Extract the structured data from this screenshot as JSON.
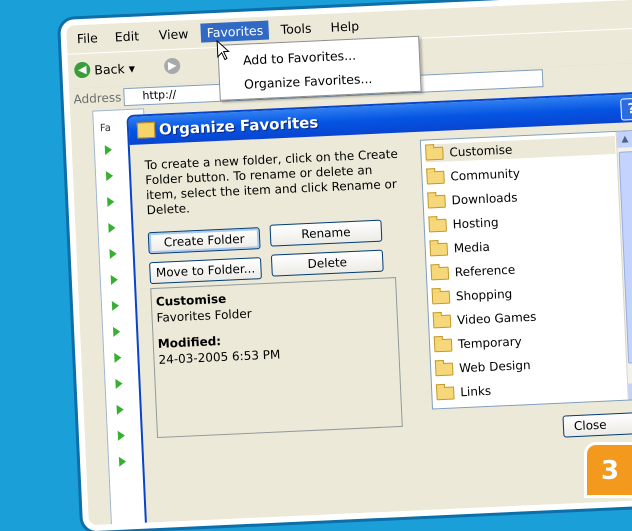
{
  "menubar": {
    "file": "File",
    "edit": "Edit",
    "view": "View",
    "favorites": "Favorites",
    "tools": "Tools",
    "help": "Help"
  },
  "toolbar": {
    "back": "Back",
    "back_arrow": "▾"
  },
  "address": {
    "label": "Address",
    "value": "http://"
  },
  "left_pane": {
    "label": "Fa"
  },
  "dropdown": {
    "add": "Add to Favorites...",
    "organize": "Organize Favorites..."
  },
  "dialog": {
    "title": "Organize Favorites",
    "help": "?",
    "instructions": "To create a new folder, click on the Create Folder button. To rename or delete an item, select the item and click Rename or Delete.",
    "create_folder": "Create Folder",
    "rename": "Rename",
    "move_to_folder": "Move to Folder...",
    "delete": "Delete",
    "info": {
      "name": "Customise",
      "type": "Favorites Folder",
      "modified_label": "Modified:",
      "modified_value": "24-03-2005 6:53 PM"
    },
    "folders": [
      "Customise",
      "Community",
      "Downloads",
      "Hosting",
      "Media",
      "Reference",
      "Shopping",
      "Video Games",
      "Temporary",
      "Web Design",
      "Links"
    ],
    "close": "Close"
  },
  "step_badge": "3",
  "colors": {
    "background": "#1a9fd9",
    "titlebar": "#0554e3",
    "accent": "#f39a1e"
  }
}
